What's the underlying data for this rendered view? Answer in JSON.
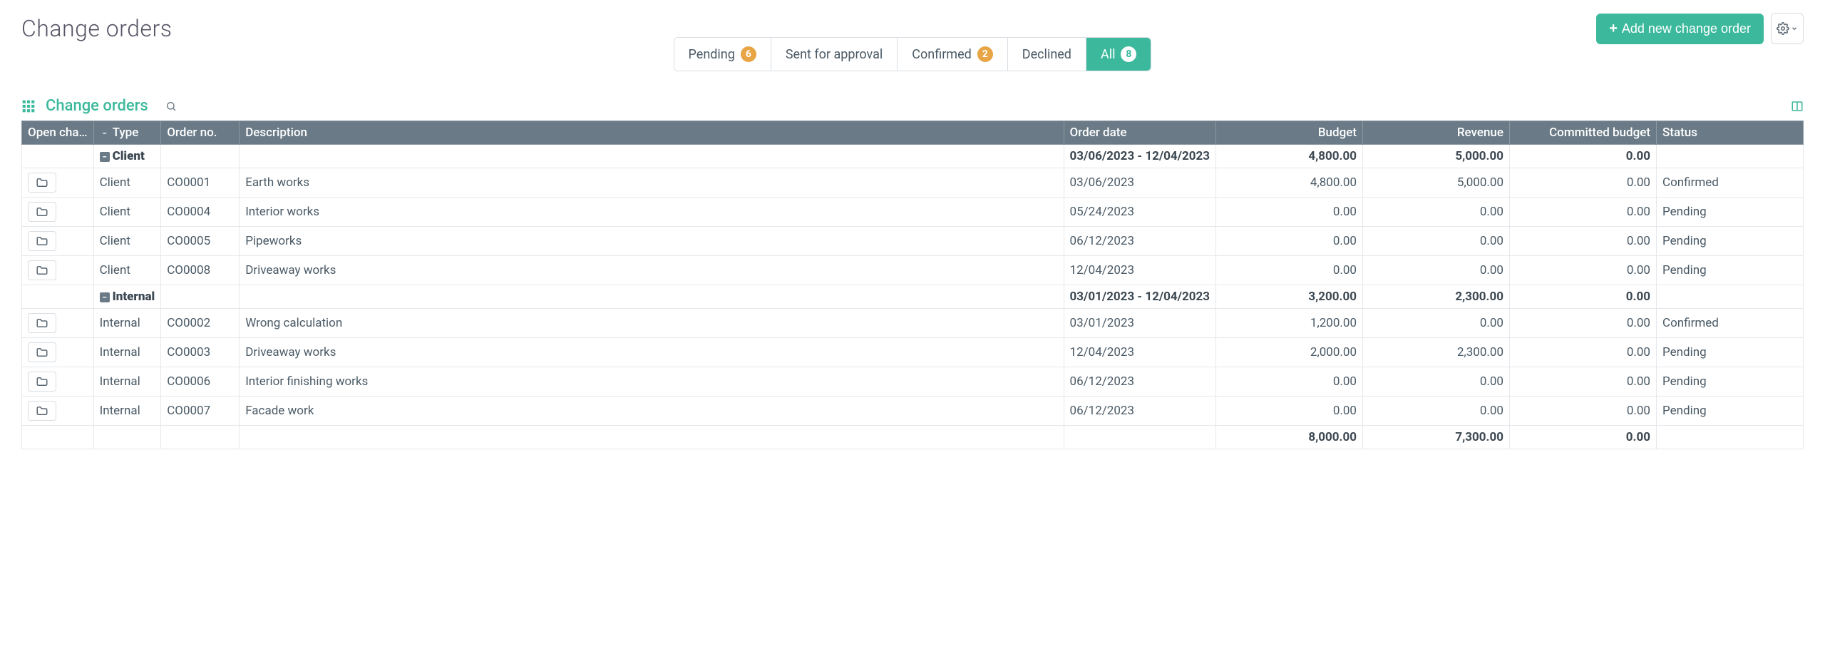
{
  "header": {
    "title": "Change orders",
    "add_button_label": "Add new change order"
  },
  "filters": {
    "tabs": [
      {
        "label": "Pending",
        "badge": "6",
        "badge_style": "amber",
        "active": false
      },
      {
        "label": "Sent for approval",
        "badge": "",
        "badge_style": "",
        "active": false
      },
      {
        "label": "Confirmed",
        "badge": "2",
        "badge_style": "amber",
        "active": false
      },
      {
        "label": "Declined",
        "badge": "",
        "badge_style": "",
        "active": false
      },
      {
        "label": "All",
        "badge": "8",
        "badge_style": "white",
        "active": true
      }
    ]
  },
  "section": {
    "title": "Change orders"
  },
  "columns": {
    "open": "Open cha…",
    "type": "Type",
    "order_no": "Order no.",
    "desc": "Description",
    "date": "Order date",
    "budget": "Budget",
    "revenue": "Revenue",
    "cbudget": "Committed budget",
    "status": "Status"
  },
  "groups": [
    {
      "name": "Client",
      "date_range": "03/06/2023 - 12/04/2023",
      "budget": "4,800.00",
      "revenue": "5,000.00",
      "cbudget": "0.00",
      "rows": [
        {
          "type": "Client",
          "order_no": "CO0001",
          "desc": "Earth works",
          "date": "03/06/2023",
          "budget": "4,800.00",
          "revenue": "5,000.00",
          "cbudget": "0.00",
          "status": "Confirmed"
        },
        {
          "type": "Client",
          "order_no": "CO0004",
          "desc": "Interior works",
          "date": "05/24/2023",
          "budget": "0.00",
          "revenue": "0.00",
          "cbudget": "0.00",
          "status": "Pending"
        },
        {
          "type": "Client",
          "order_no": "CO0005",
          "desc": "Pipeworks",
          "date": "06/12/2023",
          "budget": "0.00",
          "revenue": "0.00",
          "cbudget": "0.00",
          "status": "Pending"
        },
        {
          "type": "Client",
          "order_no": "CO0008",
          "desc": "Driveaway works",
          "date": "12/04/2023",
          "budget": "0.00",
          "revenue": "0.00",
          "cbudget": "0.00",
          "status": "Pending"
        }
      ]
    },
    {
      "name": "Internal",
      "date_range": "03/01/2023 - 12/04/2023",
      "budget": "3,200.00",
      "revenue": "2,300.00",
      "cbudget": "0.00",
      "rows": [
        {
          "type": "Internal",
          "order_no": "CO0002",
          "desc": "Wrong calculation",
          "date": "03/01/2023",
          "budget": "1,200.00",
          "revenue": "0.00",
          "cbudget": "0.00",
          "status": "Confirmed"
        },
        {
          "type": "Internal",
          "order_no": "CO0003",
          "desc": "Driveaway works",
          "date": "12/04/2023",
          "budget": "2,000.00",
          "revenue": "2,300.00",
          "cbudget": "0.00",
          "status": "Pending"
        },
        {
          "type": "Internal",
          "order_no": "CO0006",
          "desc": "Interior finishing works",
          "date": "06/12/2023",
          "budget": "0.00",
          "revenue": "0.00",
          "cbudget": "0.00",
          "status": "Pending"
        },
        {
          "type": "Internal",
          "order_no": "CO0007",
          "desc": "Facade work",
          "date": "06/12/2023",
          "budget": "0.00",
          "revenue": "0.00",
          "cbudget": "0.00",
          "status": "Pending"
        }
      ]
    }
  ],
  "totals": {
    "budget": "8,000.00",
    "revenue": "7,300.00",
    "cbudget": "0.00"
  }
}
